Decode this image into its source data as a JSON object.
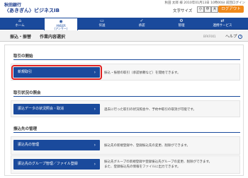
{
  "header": {
    "logo_top": "秋田銀行",
    "logo_bottom": "〈あきぎん〉ビジネスIB",
    "user_info": "秋田 太郎 様 2010年01月13日 10時00分 前回ログイン",
    "font_size_label": "文字サイズ",
    "font_sizes": [
      "小",
      "中",
      "大"
    ],
    "logout_label": "ログアウト"
  },
  "nav": {
    "items": [
      {
        "label": "ホーム",
        "icon": "⌂"
      },
      {
        "label": "ANSER\n(アンサー)",
        "icon": "◉"
      },
      {
        "label": "伝送",
        "icon": "▭"
      },
      {
        "label": "承認",
        "icon": "✓"
      },
      {
        "label": "管理",
        "icon": "⚙"
      },
      {
        "label": "連携サービス",
        "icon": "⇄"
      }
    ]
  },
  "subheader": {
    "breadcrumb": "振込・振替",
    "title": "作業内容選択",
    "screen_code": "BFKF001",
    "help_label": "ヘルプ"
  },
  "sections": [
    {
      "title": "取引の開始"
    },
    {
      "title": "取引状況の照会"
    },
    {
      "title": "振込先の管理"
    }
  ],
  "buttons": [
    {
      "label": "新規取引",
      "desc": "振込・振替の取引（承認依頼など）を開始できます。"
    },
    {
      "label": "振込データの状況照会・取消",
      "desc": "過去に行った取引の状況照会や、予約中取引の取消が可能です。"
    },
    {
      "label": "振込先の管理",
      "desc": "振込先の新規登録や、登録振込先の変更、削除ができます。"
    },
    {
      "label": "振込先のグループ管理／ファイル登録",
      "desc": "振込先グループの新規登録や登録振込先グループの変更、削除ができます。\nまた、登録振込先の情報をファイルに出力できます。"
    }
  ],
  "colors": {
    "nav_bg": "#1a4a9c",
    "button_bg": "#1a4a9c",
    "logout_bg": "#f08a1c",
    "highlight": "#e02020"
  }
}
